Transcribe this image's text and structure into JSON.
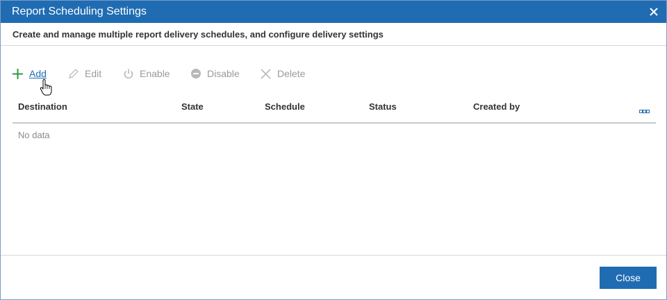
{
  "dialog": {
    "title": "Report Scheduling Settings",
    "description": "Create and manage multiple report delivery schedules, and configure delivery settings"
  },
  "toolbar": {
    "add_label": "Add",
    "edit_label": "Edit",
    "enable_label": "Enable",
    "disable_label": "Disable",
    "delete_label": "Delete"
  },
  "grid": {
    "columns": [
      "Destination",
      "State",
      "Schedule",
      "Status",
      "Created by"
    ],
    "empty_text": "No data"
  },
  "footer": {
    "close_label": "Close"
  },
  "colors": {
    "accent": "#1f6cb3",
    "add_icon": "#2e9a3a",
    "disabled_text": "#9a9a9a"
  },
  "icons": {
    "close": "close-icon",
    "add": "plus-icon",
    "edit": "pencil-icon",
    "enable": "power-icon",
    "disable": "minus-circle-icon",
    "delete": "x-icon",
    "column_menu": "column-chooser-icon",
    "cursor": "hand-pointer-icon"
  }
}
